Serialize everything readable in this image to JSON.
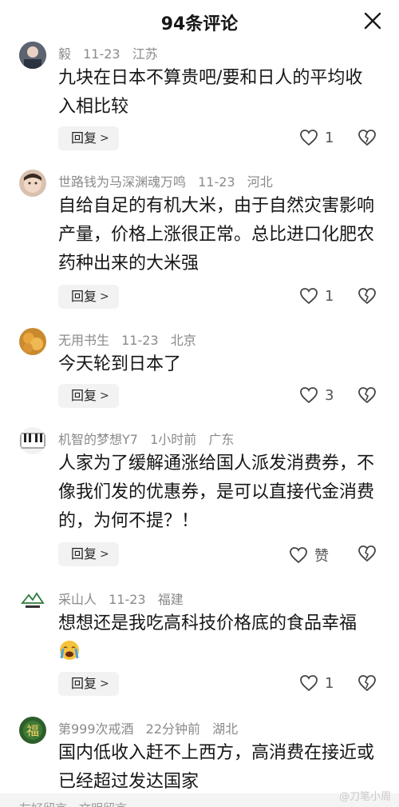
{
  "header": {
    "title": "94条评论"
  },
  "comments": [
    {
      "user": "毅",
      "time": "11-23",
      "location": "江苏",
      "text": "九块在日本不算贵吧/要和日人的平均收入相比较",
      "likes": "1"
    },
    {
      "user": "世路钱为马深渊魂万鸣",
      "time": "11-23",
      "location": "河北",
      "text": "自给自足的有机大米，由于自然灾害影响产量，价格上涨很正常。总比进口化肥农药种出来的大米强",
      "likes": "1"
    },
    {
      "user": "无用书生",
      "time": "11-23",
      "location": "北京",
      "text": "今天轮到日本了",
      "likes": "3"
    },
    {
      "user": "机智的梦想Y7",
      "time": "1小时前",
      "location": "广东",
      "text": "人家为了缓解通涨给国人派发消费券，不像我们发的优惠券，是可以直接代金消费的，为何不提？！",
      "likes": "赞"
    },
    {
      "user": "采山人",
      "time": "11-23",
      "location": "福建",
      "text": "想想还是我吃高科技价格底的食品幸福",
      "likes": "1"
    },
    {
      "user": "第999次戒酒",
      "time": "22分钟前",
      "location": "湖北",
      "text": "国内低收入赶不上西方，高消费在接近或已经超过发达国家",
      "likes": ""
    }
  ],
  "reply_label": "回复",
  "reply_chevron": ">",
  "icons": {
    "close": "close-icon",
    "like": "heart-outline-icon",
    "dislike": "broken-heart-icon"
  },
  "bottom": {
    "placeholder": "友好留言，文明留言"
  },
  "watermark": "@刀笔小周",
  "colors": {
    "meta": "#8a8a8a",
    "reply_bg": "#f2f2f2",
    "text": "#161616"
  }
}
